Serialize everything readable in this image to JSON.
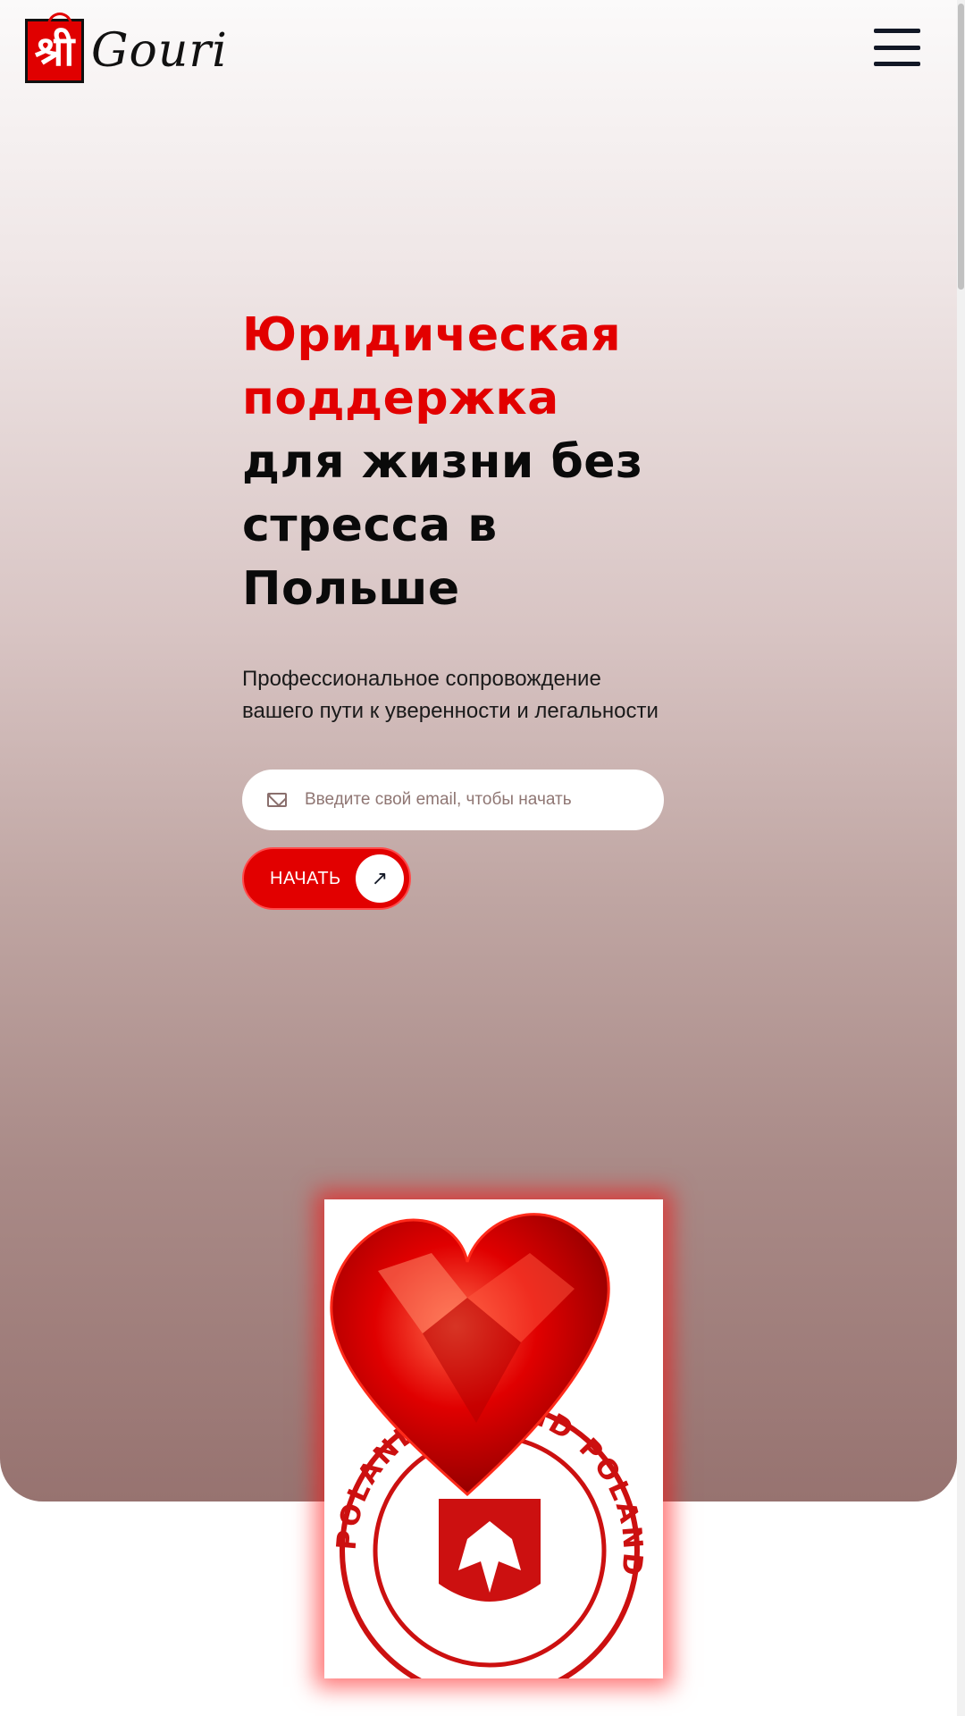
{
  "header": {
    "logo_glyph": "श्री",
    "logo_text": "Gouri",
    "menu_icon": "hamburger-menu-icon"
  },
  "hero": {
    "headline_red_1": "Юридическая",
    "headline_red_2": "поддержка",
    "headline_dark_1": "для жизни без",
    "headline_dark_2": "стресса в",
    "headline_dark_3": "Польше",
    "subtitle_line_1": "Профессиональное сопровождение",
    "subtitle_line_2": "вашего пути к уверенности и легальности",
    "email_placeholder": "Введите свой email, чтобы начать",
    "email_value": "",
    "start_label": "НАЧАТЬ",
    "arrow_glyph": "↗"
  },
  "illustration": {
    "stamp_text": "POLAND POLAND POLAND"
  },
  "colors": {
    "accent": "#e20000",
    "dark_text": "#0a0a0a",
    "hero_gradient_top": "#fbfafa",
    "hero_gradient_bottom": "#977370"
  }
}
